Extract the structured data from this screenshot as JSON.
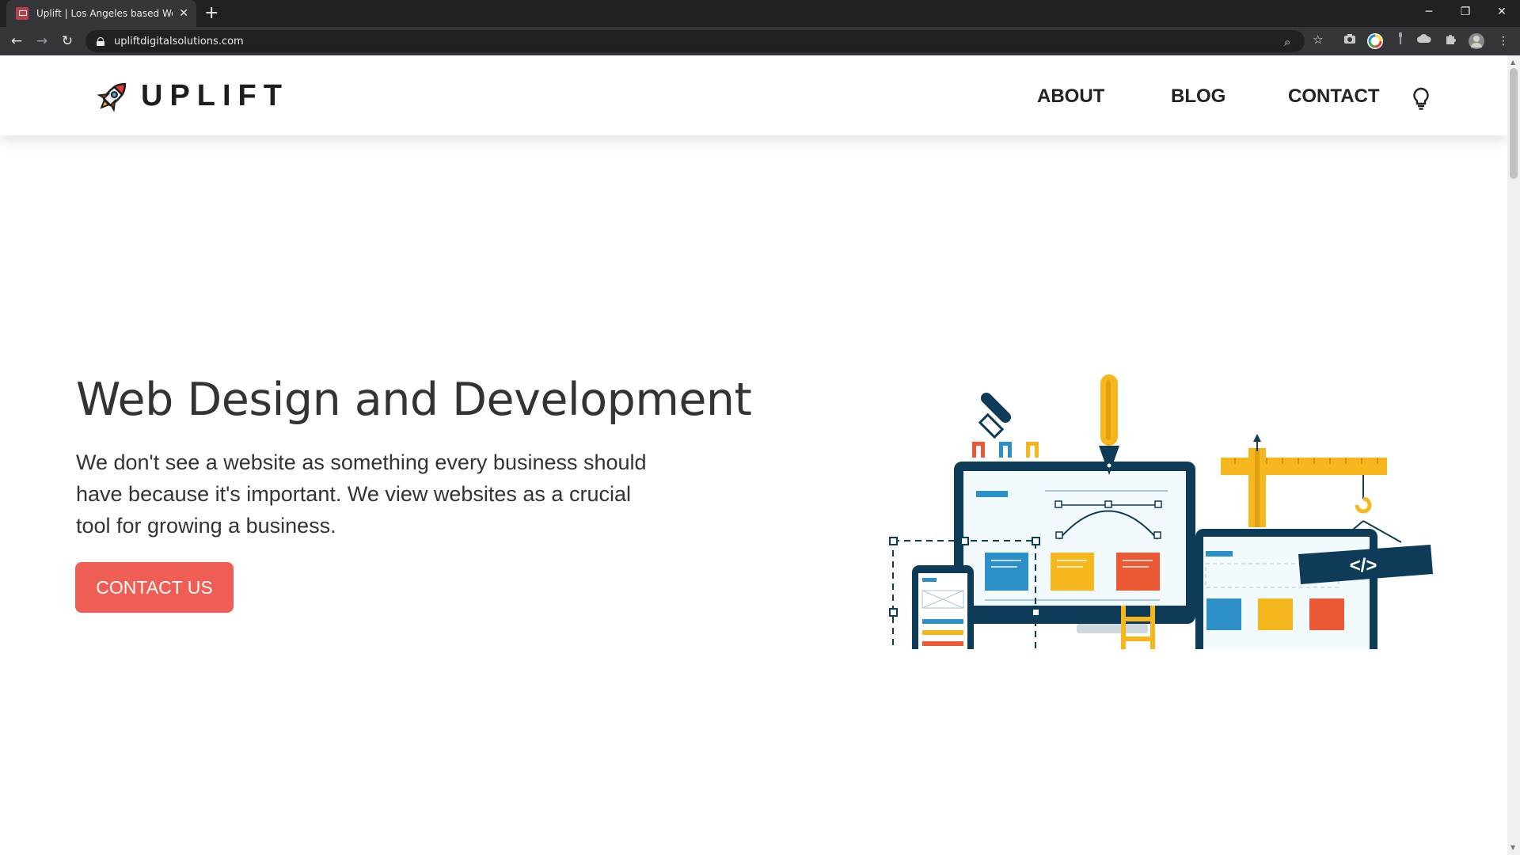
{
  "browser": {
    "tab_title": "Uplift | Los Angeles based Web D",
    "tab_close": "✕",
    "new_tab": "+",
    "url": "upliftdigitalsolutions.com",
    "controls": {
      "minimize": "─",
      "restore": "❐",
      "close": "✕"
    },
    "nav": {
      "back": "←",
      "forward": "→",
      "reload": "↻",
      "zoom": "⌕",
      "bookmark": "☆",
      "menu": "⋮"
    }
  },
  "header": {
    "logo_text": "UPLIFT",
    "nav": [
      {
        "label": "ABOUT"
      },
      {
        "label": "BLOG"
      },
      {
        "label": "CONTACT"
      }
    ]
  },
  "hero": {
    "title": "Web Design and Development",
    "text": "We don't see a website as something every business should have because it's important. We view websites as a crucial tool for growing a business.",
    "cta_label": "CONTACT US"
  },
  "illustration": {
    "code_tag": "</>"
  },
  "colors": {
    "cta": "#ee5e55",
    "navy": "#0e3b57",
    "yellow": "#f6b61e",
    "blue": "#2d8fc7",
    "red": "#eb5a34"
  }
}
